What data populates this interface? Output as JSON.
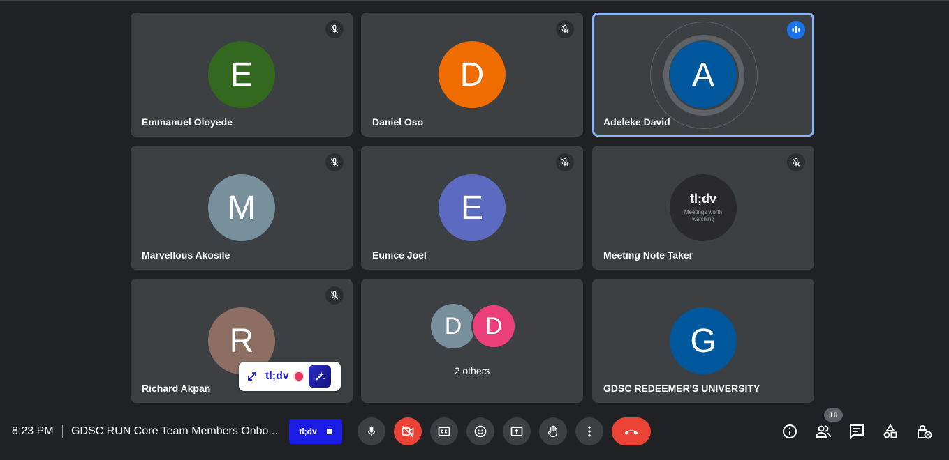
{
  "participants": [
    {
      "name": "Emmanuel Oloyede",
      "initial": "E",
      "color": "#33691e"
    },
    {
      "name": "Daniel Oso",
      "initial": "D",
      "color": "#ef6c00"
    },
    {
      "name": "Adeleke David",
      "initial": "A",
      "color": "#01579b"
    },
    {
      "name": "Marvellous Akosile",
      "initial": "M",
      "color": "#78909c"
    },
    {
      "name": "Eunice Joel",
      "initial": "E",
      "color": "#5c6bc0"
    },
    {
      "name": "Meeting Note Taker",
      "logo_text": "tl;dv",
      "logo_tagline": "Meetings worth watching"
    },
    {
      "name": "Richard Akpan",
      "initial": "R",
      "color": "#8d6e63"
    },
    {
      "name": "GDSC REDEEMER'S UNIVERSITY",
      "initial": "G",
      "color": "#01579b"
    }
  ],
  "others": {
    "caption": "2 others",
    "avatars": [
      {
        "initial": "D",
        "color": "#78909c"
      },
      {
        "initial": "D",
        "color": "#ec407a"
      }
    ]
  },
  "tldv_widget": {
    "brand": "tl;dv"
  },
  "bottom_bar": {
    "time": "8:23 PM",
    "meeting_title": "GDSC RUN Core Team Members Onbo...",
    "tldv_button_label": "tl;dv",
    "people_count": "10"
  },
  "icons": {
    "mic": "microphone-icon",
    "camera_off": "video-off-icon",
    "captions": "closed-captions-icon",
    "reactions": "emoji-icon",
    "present": "present-screen-icon",
    "raise_hand": "raise-hand-icon",
    "more": "more-options-icon",
    "hangup": "hang-up-icon",
    "info": "info-icon",
    "people": "people-icon",
    "chat": "chat-icon",
    "activities": "activities-icon",
    "host_controls": "host-controls-icon"
  },
  "colors": {
    "background": "#202124",
    "tile": "#3c4043",
    "accent": "#8ab4f8",
    "danger": "#ea4335",
    "tldv": "#1b1be6"
  }
}
